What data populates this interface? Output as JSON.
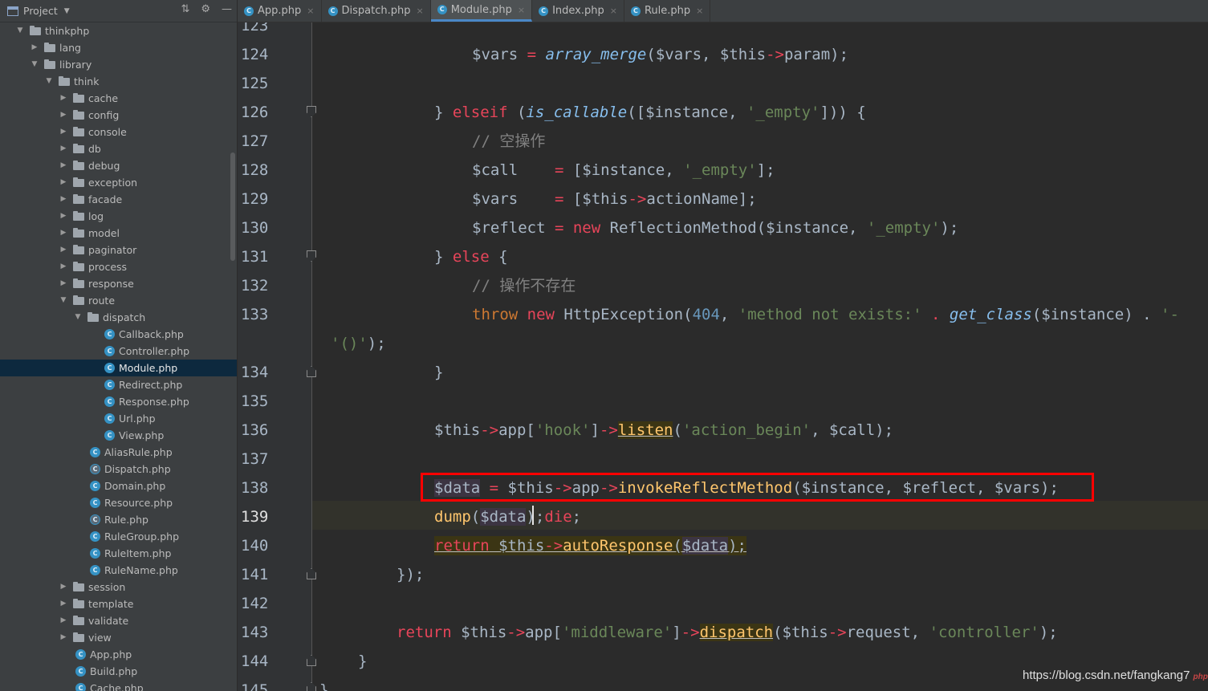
{
  "project_panel": {
    "title": "Project",
    "tree": [
      {
        "label": "thinkphp",
        "type": "folder",
        "depth": 0,
        "expanded": true
      },
      {
        "label": "lang",
        "type": "folder",
        "depth": 1,
        "expanded": false
      },
      {
        "label": "library",
        "type": "folder",
        "depth": 1,
        "expanded": true
      },
      {
        "label": "think",
        "type": "folder",
        "depth": 2,
        "expanded": true
      },
      {
        "label": "cache",
        "type": "folder",
        "depth": 3,
        "expanded": false
      },
      {
        "label": "config",
        "type": "folder",
        "depth": 3,
        "expanded": false
      },
      {
        "label": "console",
        "type": "folder",
        "depth": 3,
        "expanded": false
      },
      {
        "label": "db",
        "type": "folder",
        "depth": 3,
        "expanded": false
      },
      {
        "label": "debug",
        "type": "folder",
        "depth": 3,
        "expanded": false
      },
      {
        "label": "exception",
        "type": "folder",
        "depth": 3,
        "expanded": false
      },
      {
        "label": "facade",
        "type": "folder",
        "depth": 3,
        "expanded": false
      },
      {
        "label": "log",
        "type": "folder",
        "depth": 3,
        "expanded": false
      },
      {
        "label": "model",
        "type": "folder",
        "depth": 3,
        "expanded": false
      },
      {
        "label": "paginator",
        "type": "folder",
        "depth": 3,
        "expanded": false
      },
      {
        "label": "process",
        "type": "folder",
        "depth": 3,
        "expanded": false
      },
      {
        "label": "response",
        "type": "folder",
        "depth": 3,
        "expanded": false
      },
      {
        "label": "route",
        "type": "folder",
        "depth": 3,
        "expanded": true
      },
      {
        "label": "dispatch",
        "type": "folder",
        "depth": 4,
        "expanded": true
      },
      {
        "label": "Callback.php",
        "type": "class",
        "depth": 5
      },
      {
        "label": "Controller.php",
        "type": "class",
        "depth": 5
      },
      {
        "label": "Module.php",
        "type": "class",
        "depth": 5,
        "selected": true
      },
      {
        "label": "Redirect.php",
        "type": "class",
        "depth": 5
      },
      {
        "label": "Response.php",
        "type": "class",
        "depth": 5
      },
      {
        "label": "Url.php",
        "type": "class",
        "depth": 5
      },
      {
        "label": "View.php",
        "type": "class",
        "depth": 5
      },
      {
        "label": "AliasRule.php",
        "type": "class",
        "depth": 4
      },
      {
        "label": "Dispatch.php",
        "type": "abstract",
        "depth": 4
      },
      {
        "label": "Domain.php",
        "type": "class",
        "depth": 4
      },
      {
        "label": "Resource.php",
        "type": "class",
        "depth": 4
      },
      {
        "label": "Rule.php",
        "type": "abstract",
        "depth": 4
      },
      {
        "label": "RuleGroup.php",
        "type": "class",
        "depth": 4
      },
      {
        "label": "RuleItem.php",
        "type": "class",
        "depth": 4
      },
      {
        "label": "RuleName.php",
        "type": "class",
        "depth": 4
      },
      {
        "label": "session",
        "type": "folder",
        "depth": 3,
        "expanded": false
      },
      {
        "label": "template",
        "type": "folder",
        "depth": 3,
        "expanded": false
      },
      {
        "label": "validate",
        "type": "folder",
        "depth": 3,
        "expanded": false
      },
      {
        "label": "view",
        "type": "folder",
        "depth": 3,
        "expanded": false
      },
      {
        "label": "App.php",
        "type": "class",
        "depth": 3
      },
      {
        "label": "Build.php",
        "type": "class",
        "depth": 3
      },
      {
        "label": "Cache.php",
        "type": "class",
        "depth": 3
      }
    ]
  },
  "tabs": [
    {
      "label": "App.php",
      "icon": "C",
      "active": false
    },
    {
      "label": "Dispatch.php",
      "icon": "C",
      "active": false
    },
    {
      "label": "Module.php",
      "icon": "C",
      "active": true
    },
    {
      "label": "Index.php",
      "icon": "C",
      "active": false
    },
    {
      "label": "Rule.php",
      "icon": "C",
      "active": false
    }
  ],
  "editor": {
    "line_numbers": [
      "123",
      "124",
      "125",
      "126",
      "127",
      "128",
      "129",
      "130",
      "131",
      "132",
      "133",
      "",
      "134",
      "135",
      "136",
      "137",
      "138",
      "139",
      "140",
      "141",
      "142",
      "143",
      "144",
      "145"
    ],
    "current_line": "139",
    "highlighted_line": "138",
    "lines": {
      "l124": {
        "a": "$vars ",
        "b": "= ",
        "c": "array_merge",
        "d": "($vars, $this",
        "e": "->",
        "f": "param);"
      },
      "l126": {
        "a": "} ",
        "b": "elseif ",
        "c": "(",
        "d": "is_callable",
        "e": "([$instance, ",
        "f": "'_empty'",
        "g": "])) {"
      },
      "l127": {
        "a": "// 空操作"
      },
      "l128": {
        "a": "$call    ",
        "b": "= ",
        "c": "[$instance, ",
        "d": "'_empty'",
        "e": "];"
      },
      "l129": {
        "a": "$vars    ",
        "b": "= ",
        "c": "[$this",
        "d": "->",
        "e": "actionName];"
      },
      "l130": {
        "a": "$reflect ",
        "b": "= ",
        "c": "new ",
        "d": "ReflectionMethod($instance, ",
        "e": "'_empty'",
        "f": ");"
      },
      "l131": {
        "a": "} ",
        "b": "else ",
        "c": "{"
      },
      "l132": {
        "a": "// 操作不存在"
      },
      "l133": {
        "a": "throw ",
        "b": "new ",
        "c": "HttpException(",
        "d": "404",
        "e": ", ",
        "f": "'method not exists:'",
        "g": " . ",
        "h": "get_class",
        "i": "($instance) . ",
        "j": "'-"
      },
      "l133b": {
        "a": "'()'",
        "b": ");"
      },
      "l134": {
        "a": "}"
      },
      "l136": {
        "a": "$this",
        "b": "->",
        "c": "app[",
        "d": "'hook'",
        "e": "]",
        "f": "->",
        "g": "listen",
        "h": "(",
        "i": "'action_begin'",
        "j": ", $call);"
      },
      "l138": {
        "a": "$data",
        "b": " = ",
        "c": "$this",
        "d": "->",
        "e": "app",
        "f": "->",
        "g": "invokeReflectMethod",
        "h": "($instance, $reflect, $vars);"
      },
      "l139": {
        "a": "dump",
        "b": "(",
        "c": "$data",
        "d": ")",
        "e": ";",
        "f": "die",
        "g": ";"
      },
      "l140": {
        "a": "return",
        "b": " $this",
        "c": "->",
        "d": "autoResponse",
        "e": "(",
        "f": "$data",
        "g": ");"
      },
      "l141": {
        "a": "});"
      },
      "l143": {
        "a": "return ",
        "b": "$this",
        "c": "->",
        "d": "app[",
        "e": "'middleware'",
        "f": "]",
        "g": "->",
        "h": "dispatch",
        "i": "($this",
        "j": "->",
        "k": "request, ",
        "l": "'controller'",
        "m": ");"
      },
      "l144": {
        "a": "}"
      },
      "l145": {
        "a": "}"
      }
    }
  },
  "watermark": {
    "text": "https://blog.csdn.net/fangkang7",
    "badge": "php"
  },
  "colors": {
    "accent": "#4a88c7",
    "highlight_box": "#ff0000",
    "background": "#2b2b2b",
    "sidebar": "#3c3f41"
  }
}
